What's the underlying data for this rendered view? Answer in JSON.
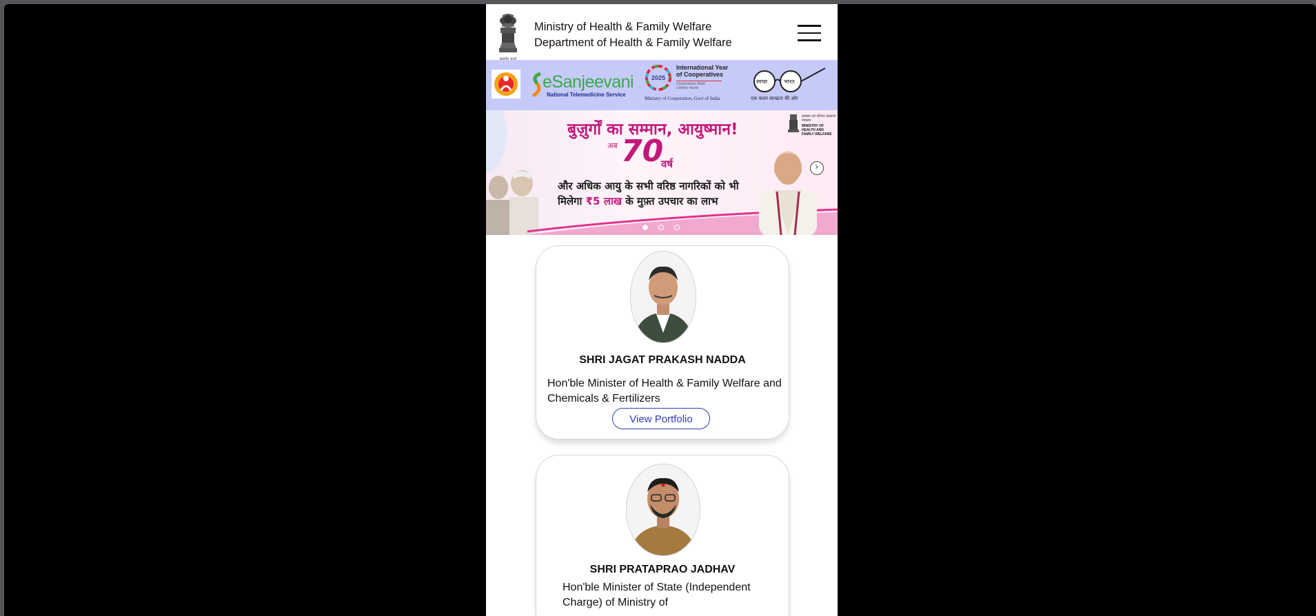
{
  "header": {
    "ministry": "Ministry of Health & Family Welfare",
    "department": "Department of Health & Family Welfare",
    "emblem_caption": "सत्यमेव जयते"
  },
  "logos": {
    "esanjeevani_name": "eSanjeevani",
    "esanjeevani_sub": "National Telemedicine Service",
    "iyc_line1": "International Year",
    "iyc_line2": "of Cooperatives",
    "iyc_line3": "Cooperatives Build",
    "iyc_line4": "a Better World",
    "iyc_year": "2025",
    "iyc_footer": "Ministry of Cooperation, Govt of India",
    "swachh_left": "स्वच्छ",
    "swachh_right": "भारत",
    "swachh_tag": "एक कदम स्वच्छता की ओर"
  },
  "banner": {
    "headline": "बुज़ुर्गों का सम्मान, आयुष्मान!",
    "ab": "अब",
    "seventy": "70",
    "varsh": "वर्ष",
    "line1": "और अधिक आयु के सभी वरिष्ठ नागरिकों को भी",
    "line2a": "मिलेगा",
    "line2b": "₹5 लाख",
    "line2c": "के मुफ़्त उपचार का लाभ",
    "ministry_badge_hi": "स्वास्थ्य एवं परिवार कल्याण मंत्रालय",
    "ministry_badge_en": "MINISTRY OF HEALTH AND FAMILY WELFARE",
    "dots": 3,
    "active_dot": 0
  },
  "ministers": [
    {
      "name": "SHRI JAGAT PRAKASH NADDA",
      "role": "Hon'ble Minister of Health & Family Welfare and Chemicals & Fertilizers",
      "button": "View Portfolio"
    },
    {
      "name": "SHRI PRATAPRAO JADHAV",
      "role": "Hon'ble Minister of State (Independent Charge) of Ministry of"
    }
  ],
  "colors": {
    "logo_strip": "#c5caf8",
    "accent_blue": "#2f3bbf",
    "banner_magenta": "#c2187a"
  }
}
